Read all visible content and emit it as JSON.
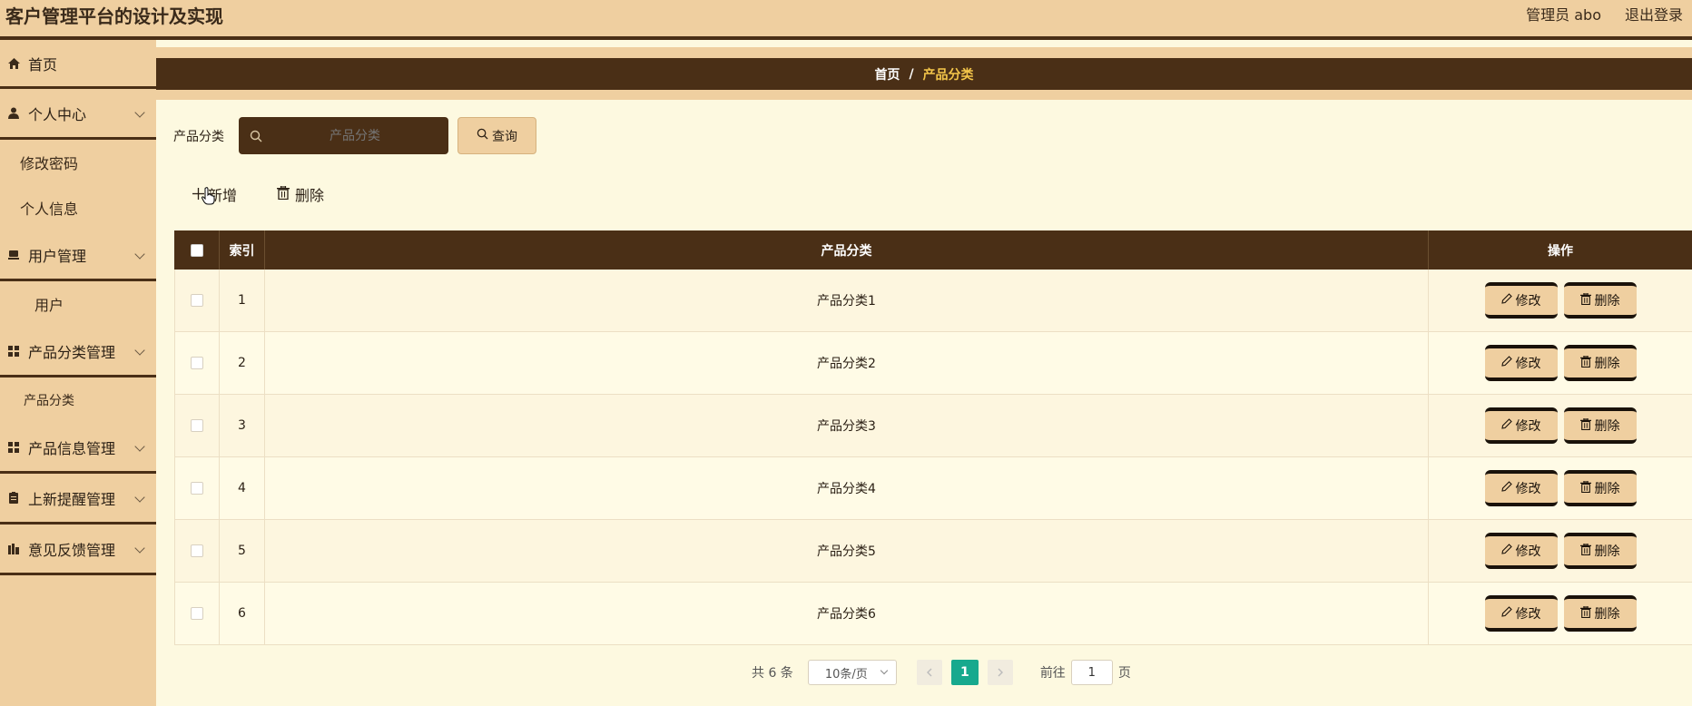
{
  "header": {
    "title": "客户管理平台的设计及实现",
    "user": "管理员 abo",
    "logout": "退出登录"
  },
  "sidebar": {
    "items": [
      {
        "label": "首页"
      },
      {
        "label": "个人中心"
      },
      {
        "label": "修改密码"
      },
      {
        "label": "个人信息"
      },
      {
        "label": "用户管理"
      },
      {
        "label": "用户"
      },
      {
        "label": "产品分类管理"
      },
      {
        "label": "产品分类"
      },
      {
        "label": "产品信息管理"
      },
      {
        "label": "上新提醒管理"
      },
      {
        "label": "意见反馈管理"
      }
    ]
  },
  "breadcrumb": {
    "home": "首页",
    "separator": "/",
    "current": "产品分类"
  },
  "search": {
    "label": "产品分类",
    "placeholder": "产品分类",
    "button": "查询"
  },
  "toolbar": {
    "add": "新增",
    "delete": "删除"
  },
  "table": {
    "headers": [
      "索引",
      "产品分类",
      "操作"
    ],
    "rows": [
      {
        "index": "1",
        "name": "产品分类1"
      },
      {
        "index": "2",
        "name": "产品分类2"
      },
      {
        "index": "3",
        "name": "产品分类3"
      },
      {
        "index": "4",
        "name": "产品分类4"
      },
      {
        "index": "5",
        "name": "产品分类5"
      },
      {
        "index": "6",
        "name": "产品分类6"
      }
    ],
    "edit_label": "修改",
    "delete_label": "删除"
  },
  "pagination": {
    "total": "共 6 条",
    "page_size": "10条/页",
    "current_page": "1",
    "goto_label": "前往",
    "goto_value": "1",
    "goto_suffix": "页"
  },
  "colors": {
    "primary_dark": "#4a2f16",
    "accent_tan": "#efcfa0",
    "background": "#fdf9e0",
    "active_page": "#17a98e",
    "breadcrumb_current": "#f4c64a"
  }
}
